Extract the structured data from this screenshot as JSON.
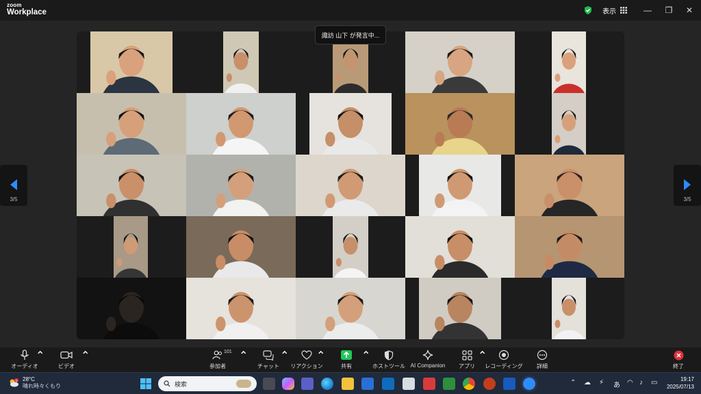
{
  "app": {
    "brand_top": "zoom",
    "brand_bottom": "Workplace"
  },
  "header": {
    "view_label": "表示",
    "minimize": "—",
    "maximize": "❐",
    "close": "✕"
  },
  "meeting": {
    "speaking_banner": "諏訪 山下 が発言中...",
    "page_left": "3/5",
    "page_right": "3/5",
    "tiles": [
      {
        "bg": "#d8c8a8",
        "shirt": "#2b3440",
        "skin": "#d9a27c",
        "hair": "#1a1a1a"
      },
      {
        "bg": "#cfc8b5",
        "shirt": "#f0f0ee",
        "skin": "#c98f6b",
        "hair": "#151515"
      },
      {
        "bg": "#b99a78",
        "shirt": "#2c2c2c",
        "skin": "#c4946e",
        "hair": "#141414"
      },
      {
        "bg": "#d6d1c8",
        "shirt": "#3a3a3a",
        "skin": "#d7a581",
        "hair": "#1c1c1c"
      },
      {
        "bg": "#e9e4dc",
        "shirt": "#c9302c",
        "skin": "#d9a27c",
        "hair": "#1a1a1a"
      },
      {
        "bg": "#c7bfae",
        "shirt": "#5d6b76",
        "skin": "#d6a07a",
        "hair": "#121212"
      },
      {
        "bg": "#cdd0cc",
        "shirt": "#f5f5f5",
        "skin": "#d2986f",
        "hair": "#1c1c1c"
      },
      {
        "bg": "#e6e3de",
        "shirt": "#e9e9e9",
        "skin": "#c58f68",
        "hair": "#161616"
      },
      {
        "bg": "#b9925e",
        "shirt": "#e8d48a",
        "skin": "#b97b54",
        "hair": "#2a2a2a"
      },
      {
        "bg": "#d4cec6",
        "shirt": "#1f2a3a",
        "skin": "#d6a07a",
        "hair": "#141414"
      },
      {
        "bg": "#c7c3b7",
        "shirt": "#303030",
        "skin": "#c99069",
        "hair": "#181818"
      },
      {
        "bg": "#b2b2ad",
        "shirt": "#f2f2f0",
        "skin": "#d4a07b",
        "hair": "#1a1a1a"
      },
      {
        "bg": "#ddd6cc",
        "shirt": "#eaeaea",
        "skin": "#d09a74",
        "hair": "#1b1b1b"
      },
      {
        "bg": "#e8e8e6",
        "shirt": "#f3f3f3",
        "skin": "#cf9a73",
        "hair": "#151515"
      },
      {
        "bg": "#c9a47c",
        "shirt": "#262626",
        "skin": "#c99069",
        "hair": "#2a2320"
      },
      {
        "bg": "#a89a86",
        "shirt": "#353535",
        "skin": "#cf9b76",
        "hair": "#141414"
      },
      {
        "bg": "#7a6a5a",
        "shirt": "#e9e9e9",
        "skin": "#c88d66",
        "hair": "#151515"
      },
      {
        "bg": "#d3cfc7",
        "shirt": "#f4f4f4",
        "skin": "#c7906a",
        "hair": "#181818"
      },
      {
        "bg": "#e2dfd8",
        "shirt": "#2a2a2a",
        "skin": "#c88e67",
        "hair": "#141414"
      },
      {
        "bg": "#b59572",
        "shirt": "#1e2a44",
        "skin": "#c48c66",
        "hair": "#171717"
      },
      {
        "bg": "#121212",
        "shirt": "#0c0c0c",
        "skin": "#2a2520",
        "hair": "#0a0a0a"
      },
      {
        "bg": "#e6e2dc",
        "shirt": "#f0f0f0",
        "skin": "#cc946d",
        "hair": "#1a1a1a"
      },
      {
        "bg": "#d8d6d0",
        "shirt": "#ececec",
        "skin": "#d3a07b",
        "hair": "#181818"
      },
      {
        "bg": "#d0ccc4",
        "shirt": "#333",
        "skin": "#b88560",
        "hair": "#161616"
      },
      {
        "bg": "#e4e0da",
        "shirt": "#f2f2f2",
        "skin": "#c98f69",
        "hair": "#181818"
      }
    ]
  },
  "toolbar": {
    "audio": "オーディオ",
    "video": "ビデオ",
    "participants": "参加者",
    "participants_count": "101",
    "chat": "チャット",
    "reactions": "リアクション",
    "share": "共有",
    "host_tools": "ホストツール",
    "ai_companion": "AI Companion",
    "apps": "アプリ",
    "recording": "レコーディング",
    "more": "詳細",
    "end": "終了"
  },
  "taskbar": {
    "temperature": "28°C",
    "weather_text": "晴れ時々くもり",
    "weather_badge": "1",
    "search_placeholder": "検索",
    "ime": "あ",
    "time": "19:17",
    "date": "2025/07/13"
  },
  "colors": {
    "share_green": "#23c65b",
    "end_red": "#e0323b",
    "shield_green": "#20b84f",
    "nav_blue": "#2d8cff"
  }
}
